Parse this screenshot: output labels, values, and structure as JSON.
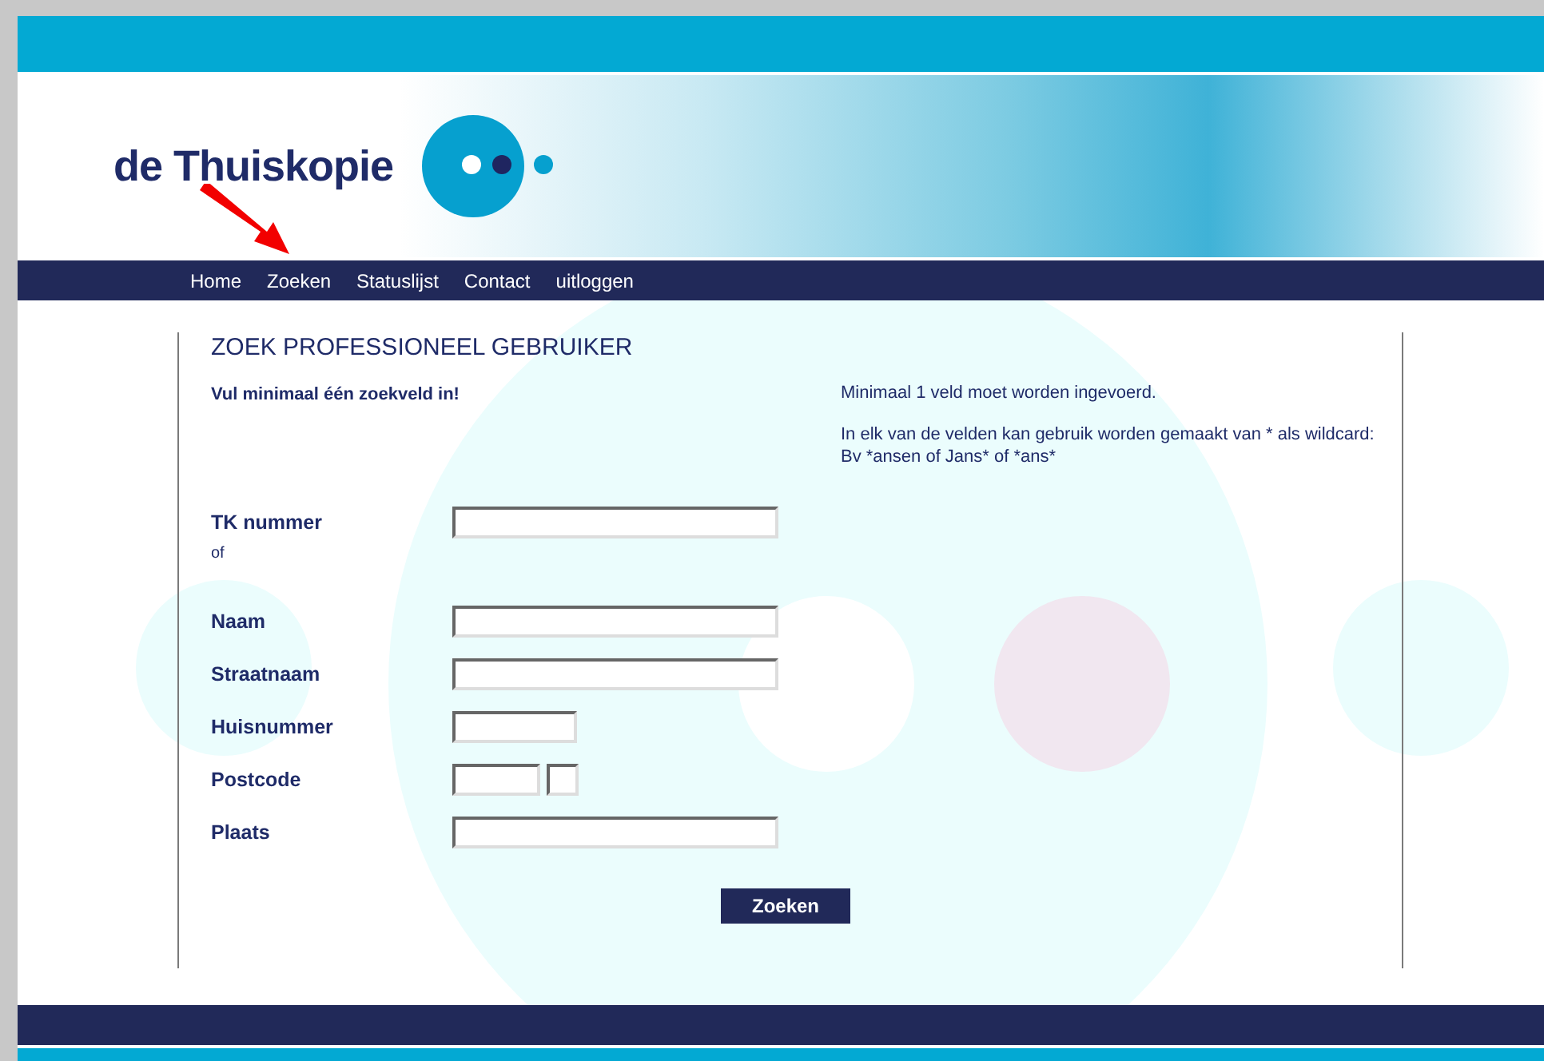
{
  "header": {
    "logo_text": "de Thuiskopie"
  },
  "nav": [
    {
      "label": "Home"
    },
    {
      "label": "Zoeken"
    },
    {
      "label": "Statuslijst"
    },
    {
      "label": "Contact"
    },
    {
      "label": "uitloggen"
    }
  ],
  "form": {
    "title": "ZOEK PROFESSIONEEL GEBRUIKER",
    "instruction": "Vul minimaal één zoekveld in!",
    "help": [
      "Minimaal 1 veld moet worden ingevoerd.",
      "In elk van de velden kan gebruik worden gemaakt van * als wildcard:\nBv *ansen of Jans* of *ans*"
    ],
    "fields": [
      {
        "label": "TK nummer",
        "note": "of",
        "inputs": [
          {
            "kind": "wide"
          }
        ]
      },
      {
        "label": "Naam",
        "inputs": [
          {
            "kind": "wide"
          }
        ]
      },
      {
        "label": "Straatnaam",
        "inputs": [
          {
            "kind": "wide"
          }
        ]
      },
      {
        "label": "Huisnummer",
        "inputs": [
          {
            "kind": "medium"
          }
        ]
      },
      {
        "label": "Postcode",
        "inputs": [
          {
            "kind": "short"
          },
          {
            "kind": "tiny"
          }
        ]
      },
      {
        "label": "Plaats",
        "inputs": [
          {
            "kind": "wide"
          }
        ]
      }
    ],
    "submit": "Zoeken"
  }
}
